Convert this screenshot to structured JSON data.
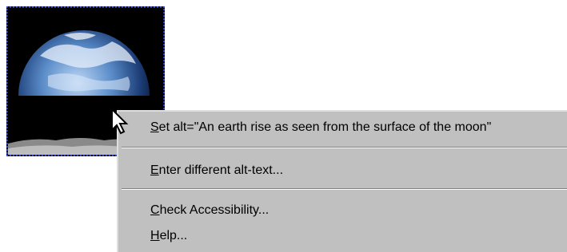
{
  "image": {
    "icon": "earthrise-image"
  },
  "context_menu": {
    "items": [
      {
        "accel": "S",
        "rest": "et alt=\"An earth rise as seen from the surface of the moon\""
      },
      {
        "accel": "E",
        "rest": "nter different alt-text..."
      },
      {
        "accel": "C",
        "rest": "heck Accessibility..."
      },
      {
        "accel": "H",
        "rest": "elp..."
      }
    ]
  },
  "colors": {
    "menu_bg": "#c0c0c0",
    "selection_border": "#2a3fd6"
  }
}
